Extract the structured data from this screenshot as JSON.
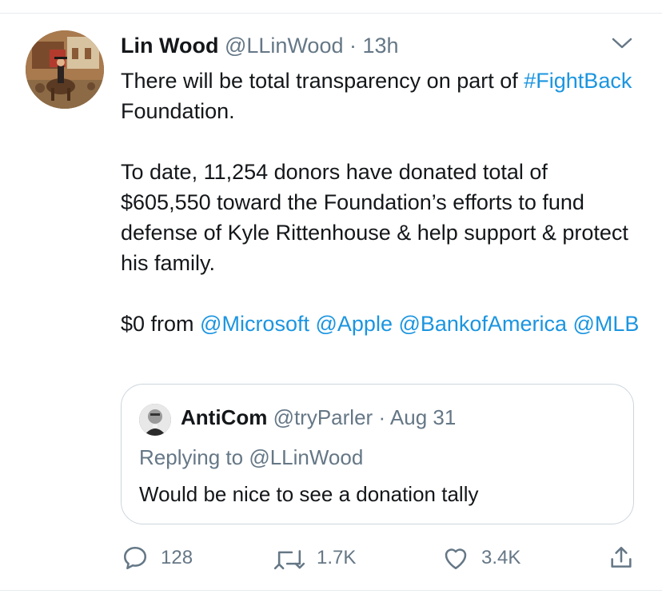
{
  "tweet": {
    "author_name": "Lin Wood",
    "author_handle": "@LLinWood",
    "separator": "·",
    "time": "13h",
    "avatar_icon": "profile-avatar",
    "menu_icon": "chevron-down-icon",
    "body": {
      "p1_text": "There will be total transparency on part of ",
      "p1_hashtag": "#FightBack",
      "p1_end": " Foundation.",
      "p2": "To date, 11,254 donors have donated total of $605,550 toward the Foundation’s efforts to fund defense of Kyle Rittenhouse & help support & protect his family.",
      "p3_prefix": "$0 from ",
      "mentions": [
        "@Microsoft",
        "@Apple",
        "@BankofAmerica",
        "@MLB"
      ]
    }
  },
  "quoted": {
    "author_name": "AntiCom",
    "author_handle": "@tryParler",
    "separator": "·",
    "date": "Aug 31",
    "replying_prefix": "Replying to ",
    "replying_handle": "@LLinWood",
    "text": "Would be nice to see a donation tally"
  },
  "actions": {
    "reply": {
      "icon": "reply-icon",
      "count": "128"
    },
    "retweet": {
      "icon": "retweet-icon",
      "count": "1.7K"
    },
    "like": {
      "icon": "heart-icon",
      "count": "3.4K"
    },
    "share": {
      "icon": "share-icon"
    }
  },
  "colors": {
    "link": "#1b95e0",
    "secondary_text": "#657786",
    "border": "#ccd6dd"
  }
}
